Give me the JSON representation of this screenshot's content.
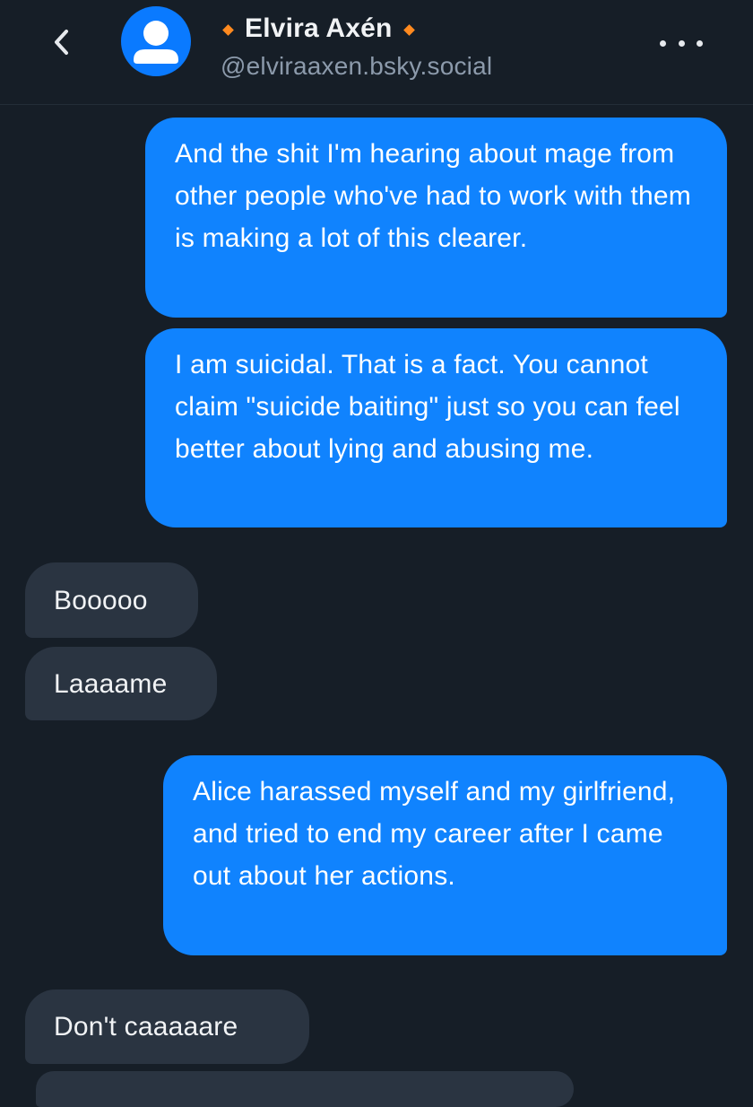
{
  "header": {
    "back_icon": "chevron-left-icon",
    "avatar_icon": "default-user-avatar-icon",
    "name": "Elvira Axén",
    "handle": "@elviraaxen.bsky.social",
    "badge_color": "#ff8a1f",
    "more_icon": "ellipsis-horizontal-icon"
  },
  "messages": [
    {
      "from": "me",
      "text": "And the shit I'm hearing about mage from other people who've had to work with them is making a lot of this clearer."
    },
    {
      "from": "me",
      "text": "I am suicidal. That is a fact. You cannot claim \"suicide baiting\" just so you can feel better about lying and abusing me."
    },
    {
      "from": "them",
      "text": "Booooo"
    },
    {
      "from": "them",
      "text": "Laaaame"
    },
    {
      "from": "me",
      "text": "Alice harassed myself and my girlfriend, and tried to end my career after I came out about her actions."
    },
    {
      "from": "them",
      "text": "Don't caaaaare"
    }
  ],
  "colors": {
    "background": "#161e27",
    "outgoing_bubble": "#1083fe",
    "incoming_bubble": "#2a3441"
  }
}
